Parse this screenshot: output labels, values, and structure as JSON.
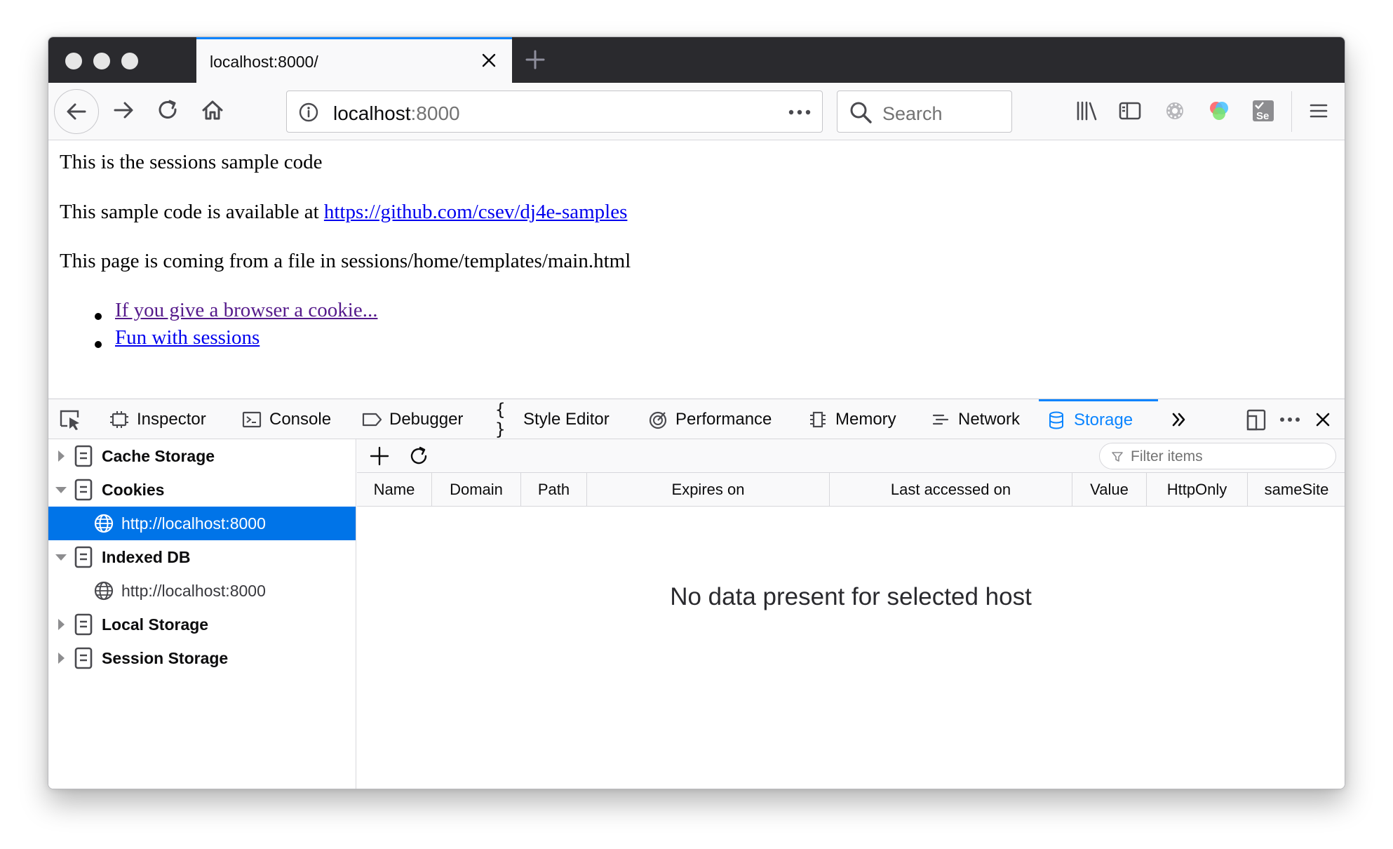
{
  "browser": {
    "tab_title": "localhost:8000/",
    "url_host": "localhost",
    "url_port": ":8000",
    "search_placeholder": "Search"
  },
  "page": {
    "line1": "This is the sessions sample code",
    "line2_prefix": "This sample code is available at ",
    "line2_link": "https://github.com/csev/dj4e-samples",
    "line3": "This page is coming from a file in sessions/home/templates/main.html",
    "links": [
      {
        "label": "If you give a browser a cookie...",
        "visited": true
      },
      {
        "label": "Fun with sessions",
        "visited": false
      }
    ]
  },
  "devtools": {
    "tabs": [
      {
        "label": "Inspector",
        "icon": "inspector-icon"
      },
      {
        "label": "Console",
        "icon": "console-icon"
      },
      {
        "label": "Debugger",
        "icon": "debugger-icon"
      },
      {
        "label": "Style Editor",
        "icon": "braces-icon"
      },
      {
        "label": "Performance",
        "icon": "performance-icon"
      },
      {
        "label": "Memory",
        "icon": "memory-icon"
      },
      {
        "label": "Network",
        "icon": "network-icon"
      },
      {
        "label": "Storage",
        "icon": "storage-icon",
        "active": true
      }
    ],
    "tree": [
      {
        "label": "Cache Storage",
        "type": "group",
        "expanded": false
      },
      {
        "label": "Cookies",
        "type": "group",
        "expanded": true
      },
      {
        "label": "http://localhost:8000",
        "type": "host",
        "selected": true
      },
      {
        "label": "Indexed DB",
        "type": "group",
        "expanded": true
      },
      {
        "label": "http://localhost:8000",
        "type": "host",
        "selected": false
      },
      {
        "label": "Local Storage",
        "type": "group",
        "expanded": false
      },
      {
        "label": "Session Storage",
        "type": "group",
        "expanded": false
      }
    ],
    "filter_placeholder": "Filter items",
    "columns": [
      "Name",
      "Domain",
      "Path",
      "Expires on",
      "Last accessed on",
      "Value",
      "HttpOnly",
      "sameSite"
    ],
    "empty_message": "No data present for selected host",
    "accent_color": "#0a84ff",
    "selection_color": "#0074e8"
  }
}
